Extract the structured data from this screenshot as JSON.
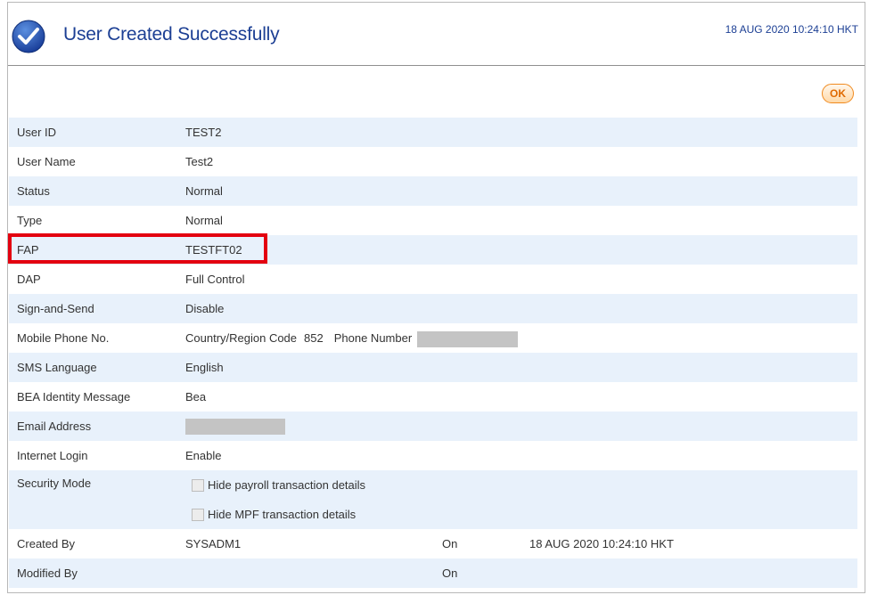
{
  "header": {
    "title": "User Created Successfully",
    "timestamp": "18 AUG 2020 10:24:10 HKT",
    "icon": "check-circle-icon"
  },
  "actions": {
    "ok_label": "OK"
  },
  "fields": {
    "user_id": {
      "label": "User ID",
      "value": "TEST2"
    },
    "user_name": {
      "label": "User Name",
      "value": "Test2"
    },
    "status": {
      "label": "Status",
      "value": "Normal"
    },
    "type": {
      "label": "Type",
      "value": "Normal"
    },
    "fap": {
      "label": "FAP",
      "value": "TESTFT02"
    },
    "dap": {
      "label": "DAP",
      "value": "Full Control"
    },
    "sign_and_send": {
      "label": "Sign-and-Send",
      "value": "Disable"
    },
    "mobile": {
      "label": "Mobile Phone No.",
      "country_label": "Country/Region Code",
      "country_code": "852",
      "phone_label": "Phone Number"
    },
    "sms_language": {
      "label": "SMS Language",
      "value": "English"
    },
    "identity_message": {
      "label": "BEA Identity Message",
      "value": "Bea"
    },
    "email": {
      "label": "Email Address"
    },
    "internet_login": {
      "label": "Internet Login",
      "value": "Enable"
    },
    "security_mode": {
      "label": "Security Mode",
      "options": [
        "Hide payroll transaction details",
        "Hide MPF transaction details"
      ]
    },
    "created_by": {
      "label": "Created By",
      "value": "SYSADM1",
      "on_label": "On",
      "on_value": "18 AUG 2020 10:24:10 HKT"
    },
    "modified_by": {
      "label": "Modified By",
      "value": "",
      "on_label": "On",
      "on_value": ""
    }
  },
  "colors": {
    "title": "#1c3f94",
    "row_shade": "#e8f1fb",
    "ok_button": "#f08a1f",
    "highlight": "#e3000f"
  }
}
